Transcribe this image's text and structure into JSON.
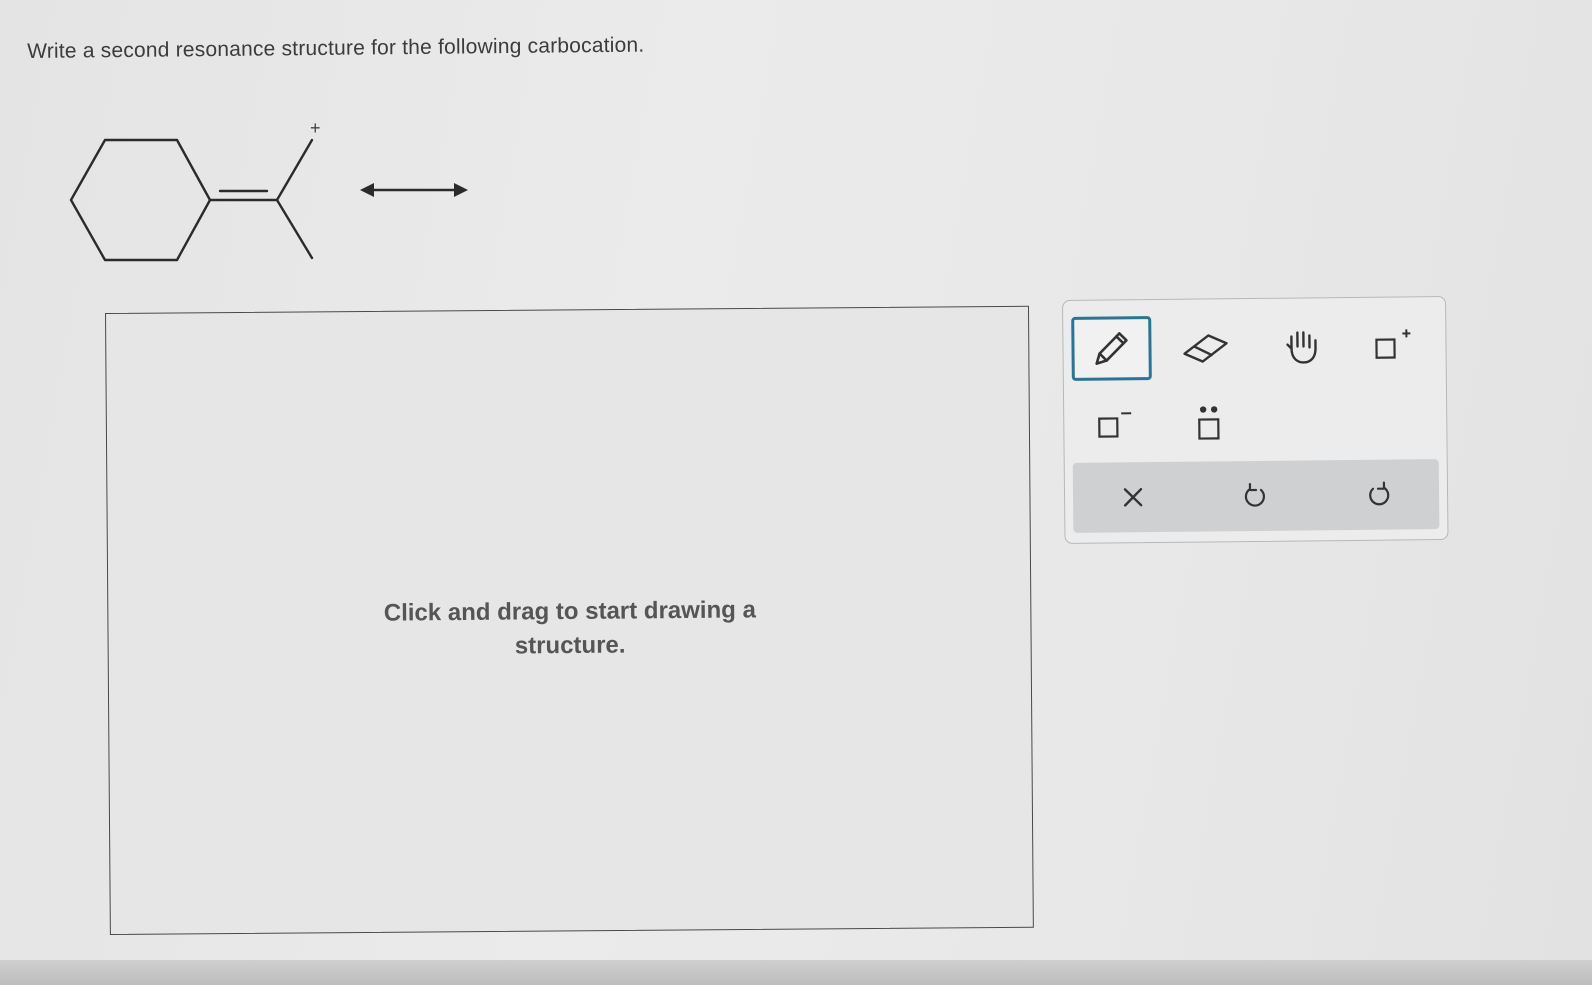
{
  "question": {
    "text": "Write a second resonance structure for the following carbocation."
  },
  "molecule": {
    "charge_label": "+"
  },
  "canvas": {
    "hint": "Click and drag to start drawing a structure."
  },
  "toolbar": {
    "tools": [
      {
        "name": "pencil-tool",
        "icon": "pencil-icon",
        "selected": true
      },
      {
        "name": "eraser-tool",
        "icon": "eraser-icon",
        "selected": false
      },
      {
        "name": "hand-tool",
        "icon": "hand-icon",
        "selected": false
      },
      {
        "name": "positive-charge-tool",
        "icon": "positive-charge-icon",
        "selected": false
      },
      {
        "name": "negative-charge-tool",
        "icon": "negative-charge-icon",
        "selected": false
      },
      {
        "name": "lone-pair-tool",
        "icon": "lone-pair-icon",
        "selected": false
      }
    ],
    "actions": [
      {
        "name": "clear-button",
        "icon": "close-icon"
      },
      {
        "name": "undo-button",
        "icon": "undo-icon"
      },
      {
        "name": "redo-button",
        "icon": "redo-icon"
      }
    ],
    "accent_color": "#2a7591"
  }
}
